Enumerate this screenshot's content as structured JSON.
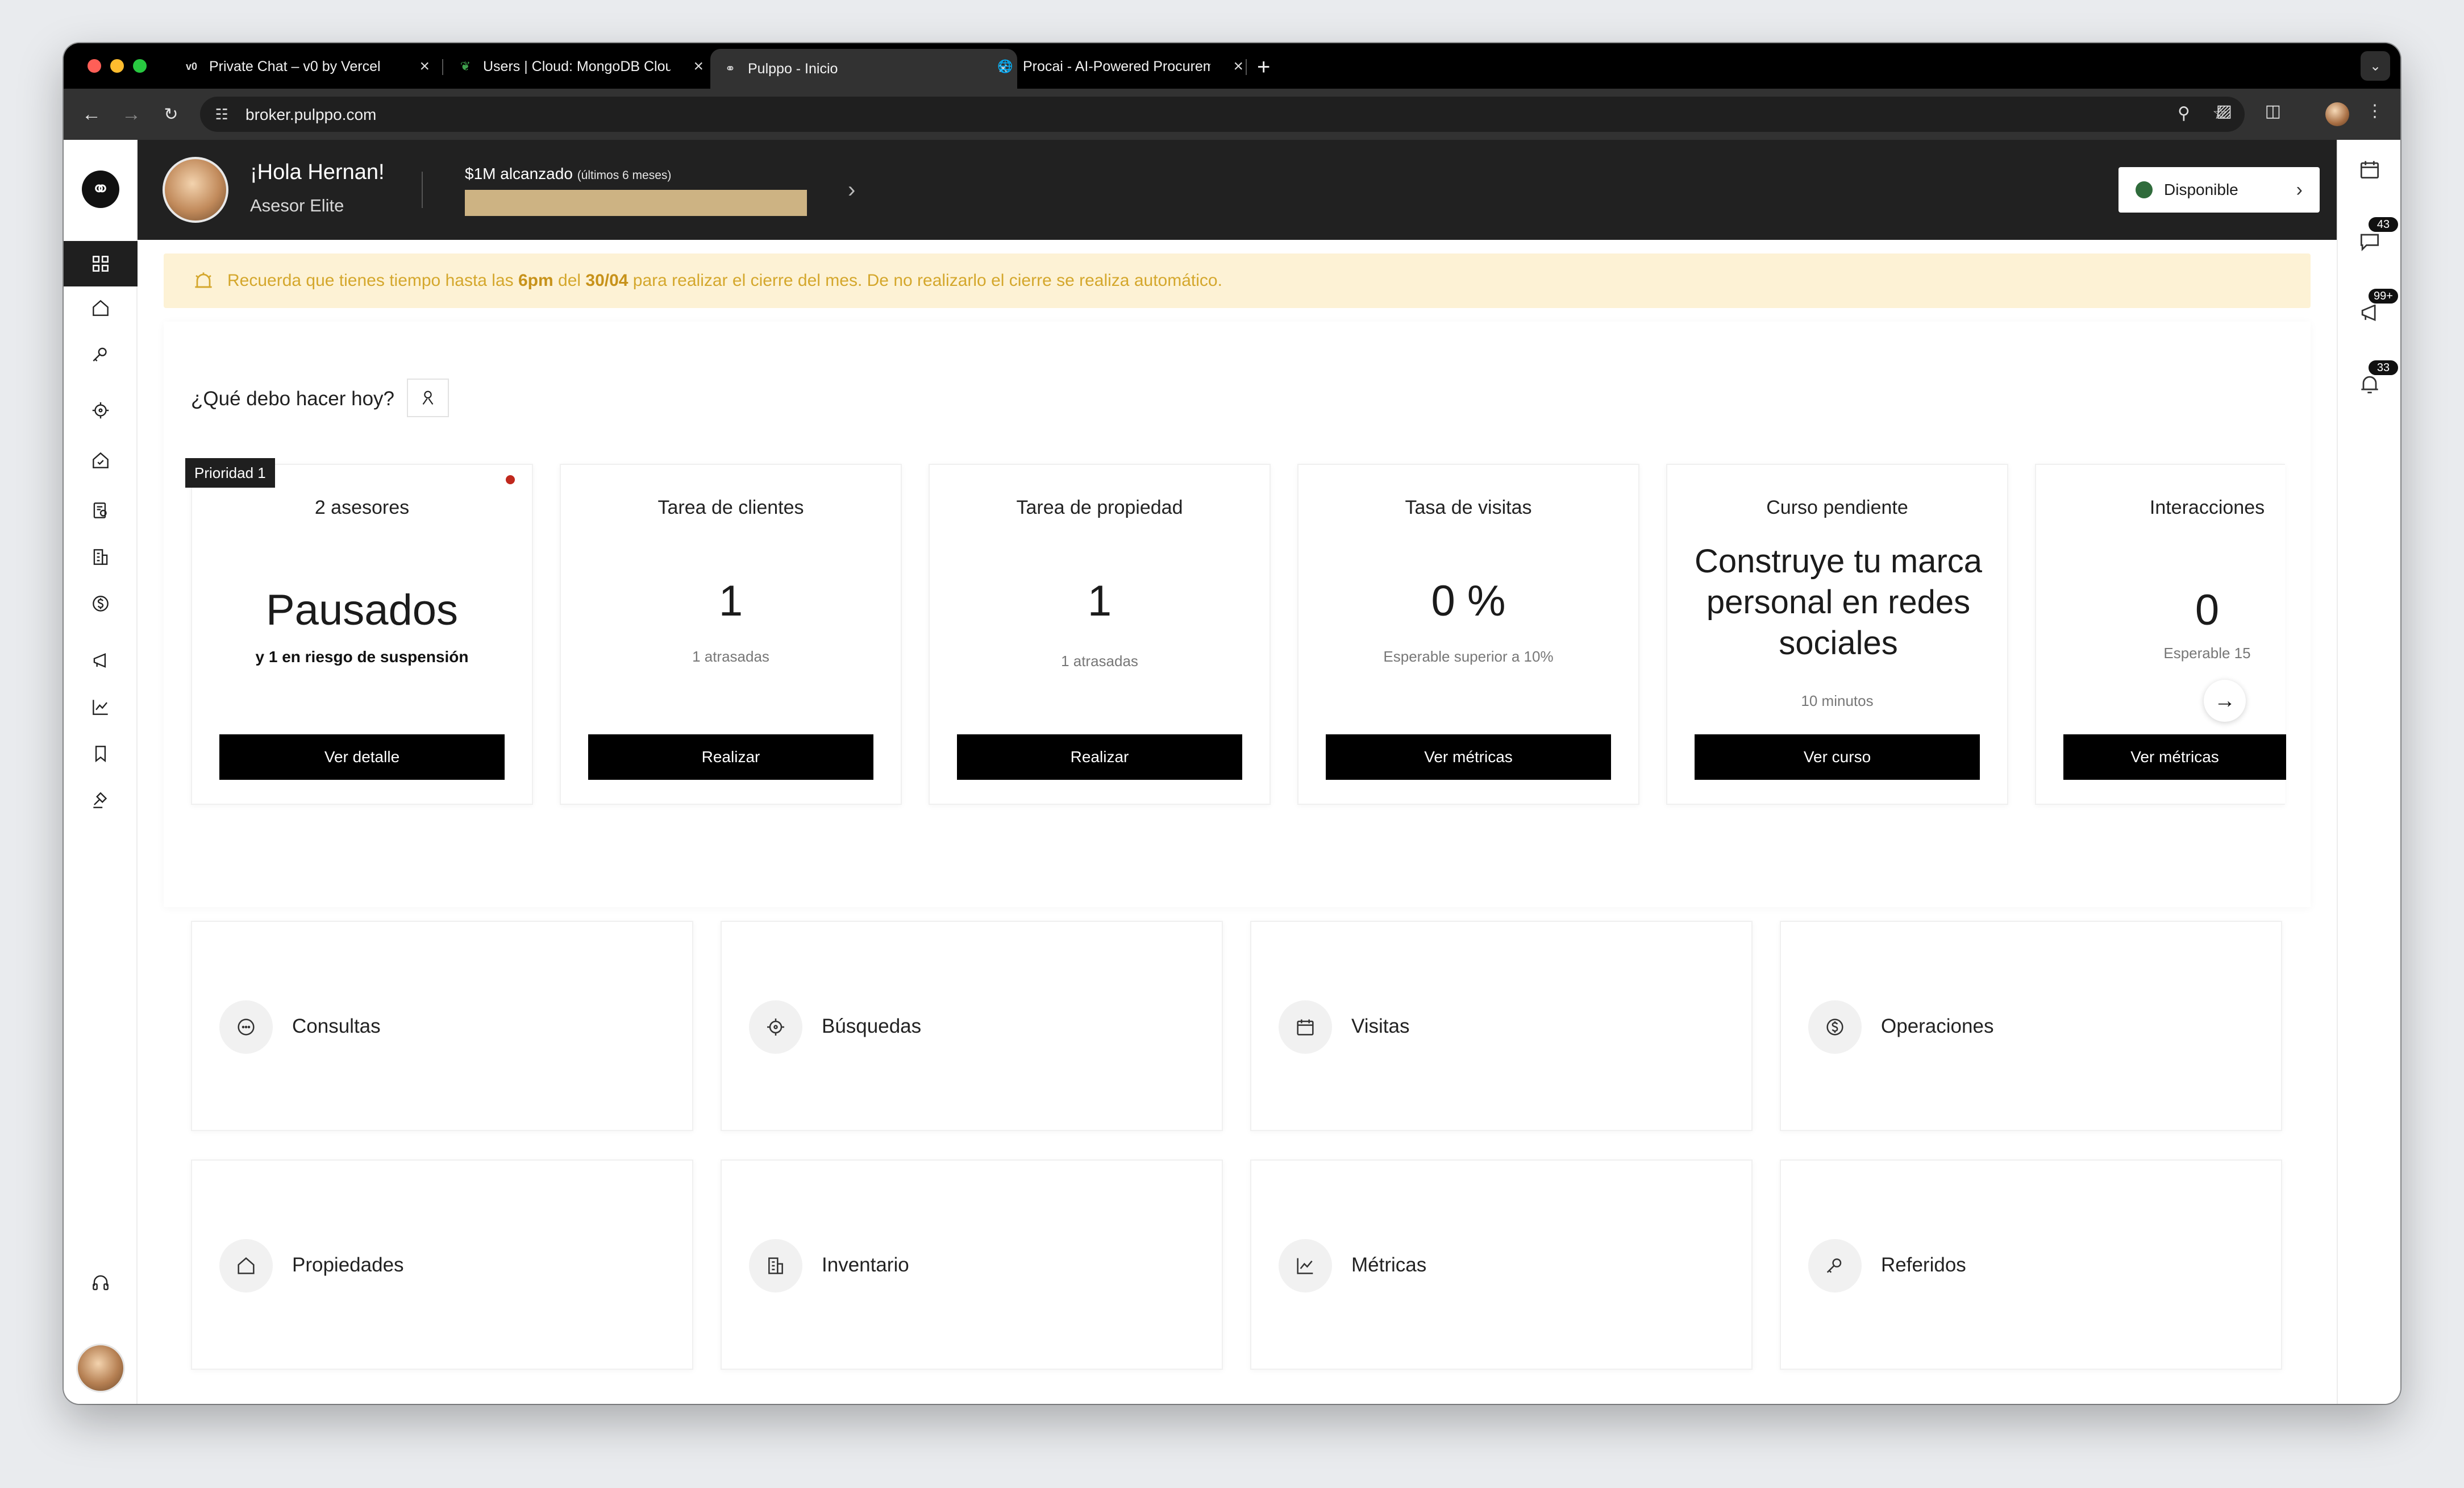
{
  "browser": {
    "tabs": [
      {
        "title": "Private Chat – v0 by Vercel",
        "icon": "v0-icon"
      },
      {
        "title": "Users | Cloud: MongoDB Cloud",
        "icon": "mongodb-leaf-icon"
      },
      {
        "title": "Pulppo - Inicio",
        "icon": "pulppo-icon",
        "active": true
      },
      {
        "title": "Procai - AI-Powered Procurement",
        "icon": "globe-icon"
      }
    ],
    "url": "broker.pulppo.com"
  },
  "header": {
    "greeting": "¡Hola Hernan!",
    "role": "Asesor Elite",
    "goal_label": "$1M alcanzado",
    "goal_period": "(últimos 6 meses)",
    "status_label": "Disponible",
    "status_color": "#2f6b3b"
  },
  "alert": {
    "prefix": "Recuerda que tienes tiempo hasta las ",
    "time": "6pm",
    "middle": " del ",
    "date": "30/04",
    "suffix": " para realizar el cierre del mes. De no realizarlo el cierre se realiza automático."
  },
  "today": {
    "title": "¿Qué debo hacer hoy?",
    "cards": [
      {
        "title": "2 asesores",
        "big": "Pausados",
        "sub": "y 1 en riesgo de suspensión",
        "button": "Ver detalle",
        "badge": "Prioridad 1"
      },
      {
        "title": "Tarea de clientes",
        "big": "1",
        "sub": "1 atrasadas",
        "button": "Realizar"
      },
      {
        "title": "Tarea de propiedad",
        "big": "1",
        "sub": "1 atrasadas",
        "button": "Realizar"
      },
      {
        "title": "Tasa de visitas",
        "big": "0 %",
        "sub": "Esperable superior a 10%",
        "button": "Ver métricas"
      },
      {
        "title": "Curso pendiente",
        "big": "Construye tu marca personal en redes sociales",
        "sub": "10 minutos",
        "button": "Ver curso"
      },
      {
        "title": "Interacciones",
        "big": "0",
        "sub": "Esperable 15",
        "button": "Ver métricas"
      }
    ]
  },
  "sections": [
    {
      "label": "Consultas",
      "icon": "chat-bubble-icon"
    },
    {
      "label": "Búsquedas",
      "icon": "crosshair-icon"
    },
    {
      "label": "Visitas",
      "icon": "calendar-icon"
    },
    {
      "label": "Operaciones",
      "icon": "dollar-circle-icon"
    },
    {
      "label": "Propiedades",
      "icon": "home-icon"
    },
    {
      "label": "Inventario",
      "icon": "building-icon"
    },
    {
      "label": "Métricas",
      "icon": "chart-line-icon"
    },
    {
      "label": "Referidos",
      "icon": "key-icon"
    }
  ],
  "right_rail": {
    "badges": [
      "43",
      "99+",
      "33"
    ]
  }
}
